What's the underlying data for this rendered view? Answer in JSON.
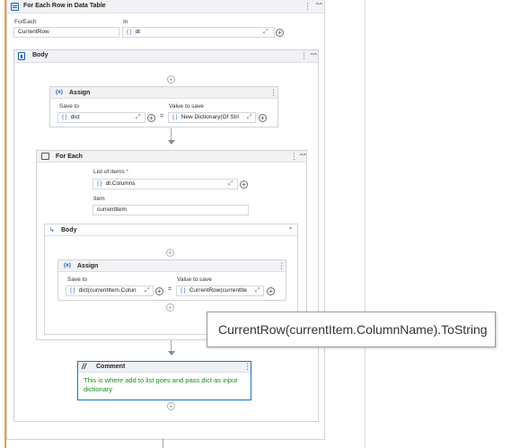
{
  "for_each_row": {
    "title": "For Each Row in Data Table",
    "foreach_label": "ForEach",
    "foreach_value": "CurrentRow",
    "in_label": "In",
    "in_value": "dt"
  },
  "outer_body": {
    "title": "Body"
  },
  "assign1": {
    "title": "Assign",
    "save_to_label": "Save to",
    "save_to_value": "dict",
    "value_label": "Value to save",
    "value_value": "New Dictionary(Of Stri"
  },
  "for_each": {
    "title": "For Each",
    "list_label": "List of items",
    "required_mark": "*",
    "list_value": "dt.Columns",
    "item_label": "Item",
    "item_value": "currentItem"
  },
  "inner_body": {
    "title": "Body"
  },
  "assign2": {
    "title": "Assign",
    "save_to_label": "Save to",
    "save_to_value": "dict(currentItem.Colun",
    "value_label": "Value to save",
    "value_value": "CurrentRow(currentIte"
  },
  "tooltip": {
    "text": "CurrentRow(currentItem.ColumnName).ToString"
  },
  "comment": {
    "title": "Comment",
    "text": "This is where add to list goes and pass dict as input dictionary"
  },
  "glyphs": {
    "bracket": "{ }",
    "plus": "+",
    "equals": "=",
    "expand": "⤢",
    "kebab": "⋮",
    "collapse": "⌃",
    "double_collapse": "⌃⌃",
    "required_star": "*"
  },
  "colors": {
    "accent_orange": "#f0a030",
    "comment_blue": "#1a6fd1",
    "comment_text": "#1a8a1a",
    "variable_blue": "#1a5fb4"
  }
}
